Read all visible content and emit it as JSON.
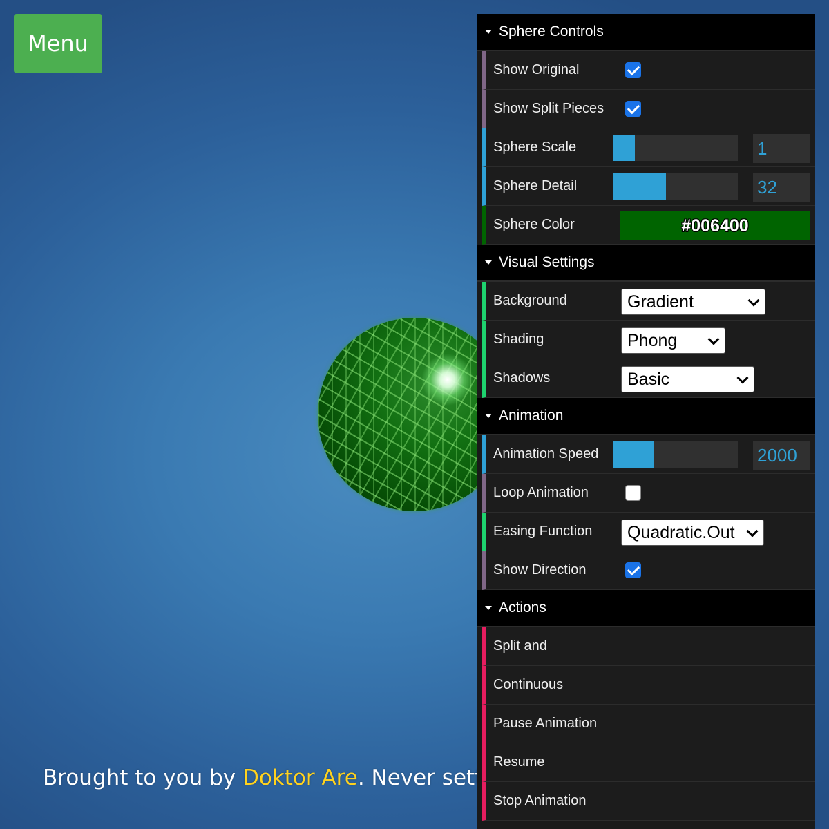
{
  "menu": {
    "label": "Menu"
  },
  "credit": {
    "prefix": "Brought to you by ",
    "link": "Doktor Are",
    "suffix": ". Never settle for"
  },
  "colors": {
    "background_top": "#244f85",
    "background_center": "#4a8cc0",
    "sphere": "#006400",
    "menu_button": "#4caf50",
    "slider_accent": "#2fa1d6",
    "credit_link": "#ffd21e"
  },
  "sphere_controls": {
    "title": "Sphere Controls",
    "show_original": {
      "label": "Show Original",
      "checked": true
    },
    "show_split_pieces": {
      "label": "Show Split Pieces",
      "checked": true
    },
    "sphere_scale": {
      "label": "Sphere Scale",
      "value": "1",
      "fill_fraction": 0.17
    },
    "sphere_detail": {
      "label": "Sphere Detail",
      "value": "32",
      "fill_fraction": 0.42
    },
    "sphere_color": {
      "label": "Sphere Color",
      "value": "#006400"
    }
  },
  "visual_settings": {
    "title": "Visual Settings",
    "background": {
      "label": "Background",
      "selected": "Gradient"
    },
    "shading": {
      "label": "Shading",
      "selected": "Phong"
    },
    "shadows": {
      "label": "Shadows",
      "selected": "Basic"
    }
  },
  "animation": {
    "title": "Animation",
    "animation_speed": {
      "label": "Animation Speed",
      "value": "2000",
      "fill_fraction": 0.33
    },
    "loop_animation": {
      "label": "Loop Animation",
      "checked": false
    },
    "easing_function": {
      "label": "Easing Function",
      "selected": "Quadratic.Out"
    },
    "show_direction": {
      "label": "Show Direction",
      "checked": true
    }
  },
  "actions": {
    "title": "Actions",
    "items": [
      "Split and",
      "Continuous",
      "Pause Animation",
      "Resume",
      "Stop Animation"
    ]
  }
}
